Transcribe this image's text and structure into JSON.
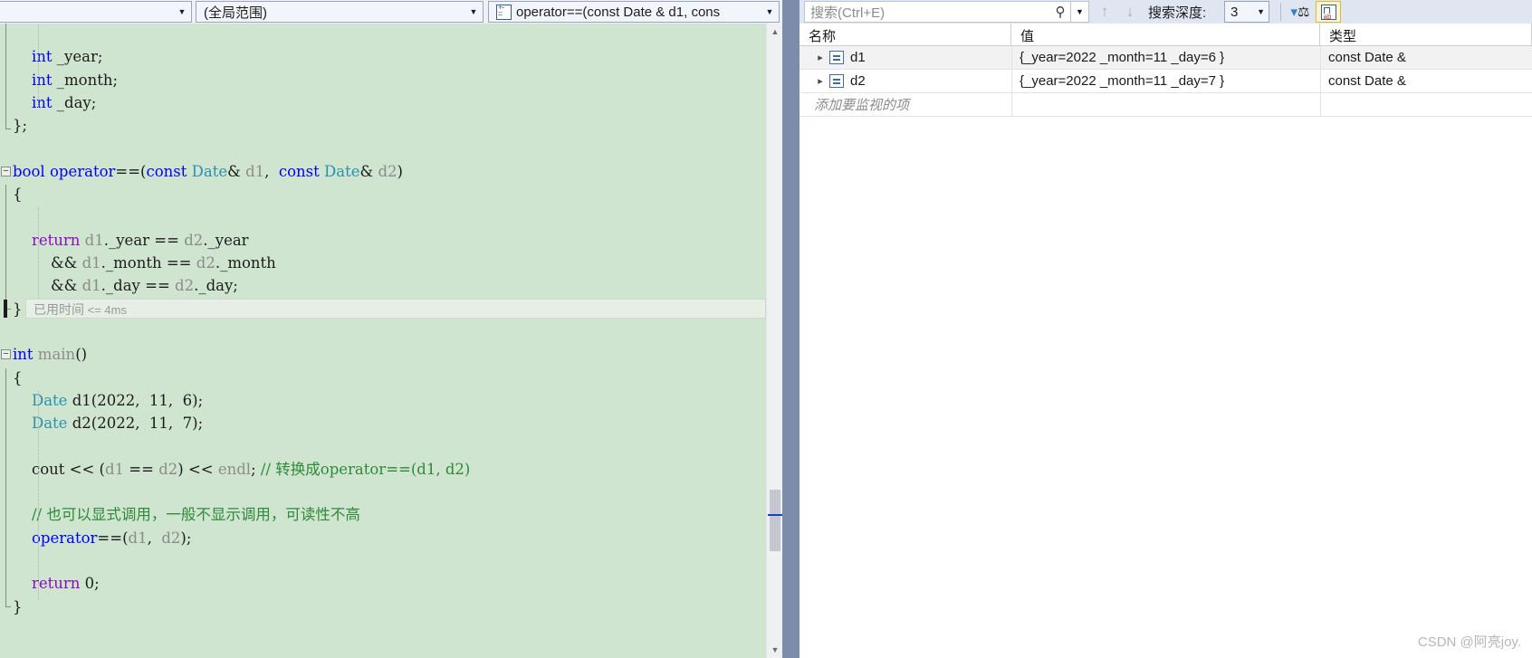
{
  "toolbar": {
    "scope_left": "",
    "global_scope": "(全局范围)",
    "current_function": "operator==(const Date & d1, cons",
    "function_icon": "function-icon",
    "split_icon": "split-view-icon",
    "dropdown_arrow": "▼"
  },
  "watch_toolbar": {
    "search_placeholder": "搜索(Ctrl+E)",
    "search_value": "",
    "search_icon": "magnifier-icon",
    "search_dropdown": "▼",
    "prev_icon": "↑",
    "next_icon": "↓",
    "depth_label": "搜索深度:",
    "depth_value": "3",
    "depth_arrow": "▼",
    "pin_icon": "pin-icon",
    "hex_icon": "hex-display-icon"
  },
  "watch": {
    "columns": [
      "名称",
      "值",
      "类型"
    ],
    "rows": [
      {
        "expander": "▸",
        "icon": "object-icon",
        "name": "d1",
        "value": "{_year=2022 _month=11 _day=6 }",
        "type": "const Date &"
      },
      {
        "expander": "▸",
        "icon": "object-icon",
        "name": "d2",
        "value": "{_year=2022 _month=11 _day=7 }",
        "type": "const Date &"
      }
    ],
    "add_item_placeholder": "添加要监视的项"
  },
  "editor": {
    "elapsed_label": "已用时间",
    "elapsed_value": "<= 4ms",
    "lines": [
      {
        "indent": 0,
        "tokens": []
      },
      {
        "indent": 0,
        "tokens": [
          {
            "t": "    ",
            "c": "pln"
          },
          {
            "t": "int",
            "c": "kw"
          },
          {
            "t": " _year;",
            "c": "pln"
          }
        ]
      },
      {
        "indent": 0,
        "tokens": [
          {
            "t": "    ",
            "c": "pln"
          },
          {
            "t": "int",
            "c": "kw"
          },
          {
            "t": " _month;",
            "c": "pln"
          }
        ]
      },
      {
        "indent": 0,
        "tokens": [
          {
            "t": "    ",
            "c": "pln"
          },
          {
            "t": "int",
            "c": "kw"
          },
          {
            "t": " _day;",
            "c": "pln"
          }
        ]
      },
      {
        "indent": 0,
        "tokens": [
          {
            "t": "};",
            "c": "pln"
          }
        ]
      },
      {
        "indent": 0,
        "tokens": []
      },
      {
        "indent": 0,
        "tokens": [
          {
            "t": "bool",
            "c": "kw"
          },
          {
            "t": " ",
            "c": "pln"
          },
          {
            "t": "operator",
            "c": "kw"
          },
          {
            "t": "==(",
            "c": "pln"
          },
          {
            "t": "const",
            "c": "kw"
          },
          {
            "t": " ",
            "c": "pln"
          },
          {
            "t": "Date",
            "c": "typ"
          },
          {
            "t": "& ",
            "c": "pln"
          },
          {
            "t": "d1",
            "c": "var"
          },
          {
            "t": ",  ",
            "c": "pln"
          },
          {
            "t": "const",
            "c": "kw"
          },
          {
            "t": " ",
            "c": "pln"
          },
          {
            "t": "Date",
            "c": "typ"
          },
          {
            "t": "& ",
            "c": "pln"
          },
          {
            "t": "d2",
            "c": "var"
          },
          {
            "t": ")",
            "c": "pln"
          }
        ]
      },
      {
        "indent": 0,
        "tokens": [
          {
            "t": "{",
            "c": "pln"
          }
        ]
      },
      {
        "indent": 0,
        "tokens": []
      },
      {
        "indent": 0,
        "tokens": [
          {
            "t": "    ",
            "c": "pln"
          },
          {
            "t": "return",
            "c": "ctl"
          },
          {
            "t": " ",
            "c": "pln"
          },
          {
            "t": "d1",
            "c": "var"
          },
          {
            "t": "._year == ",
            "c": "pln"
          },
          {
            "t": "d2",
            "c": "var"
          },
          {
            "t": "._year",
            "c": "pln"
          }
        ]
      },
      {
        "indent": 0,
        "tokens": [
          {
            "t": "        && ",
            "c": "pln"
          },
          {
            "t": "d1",
            "c": "var"
          },
          {
            "t": "._month == ",
            "c": "pln"
          },
          {
            "t": "d2",
            "c": "var"
          },
          {
            "t": "._month",
            "c": "pln"
          }
        ]
      },
      {
        "indent": 0,
        "tokens": [
          {
            "t": "        && ",
            "c": "pln"
          },
          {
            "t": "d1",
            "c": "var"
          },
          {
            "t": "._day == ",
            "c": "pln"
          },
          {
            "t": "d2",
            "c": "var"
          },
          {
            "t": "._day;",
            "c": "pln"
          }
        ]
      },
      {
        "indent": 0,
        "tokens": [
          {
            "t": "}",
            "c": "pln"
          }
        ]
      },
      {
        "indent": 0,
        "tokens": []
      },
      {
        "indent": 0,
        "tokens": [
          {
            "t": "int",
            "c": "kw"
          },
          {
            "t": " ",
            "c": "pln"
          },
          {
            "t": "main",
            "c": "var"
          },
          {
            "t": "()",
            "c": "pln"
          }
        ]
      },
      {
        "indent": 0,
        "tokens": [
          {
            "t": "{",
            "c": "pln"
          }
        ]
      },
      {
        "indent": 0,
        "tokens": [
          {
            "t": "    ",
            "c": "pln"
          },
          {
            "t": "Date",
            "c": "typ"
          },
          {
            "t": " ",
            "c": "pln"
          },
          {
            "t": "d1",
            "c": "pln"
          },
          {
            "t": "(2022,  11,  6);",
            "c": "pln"
          }
        ]
      },
      {
        "indent": 0,
        "tokens": [
          {
            "t": "    ",
            "c": "pln"
          },
          {
            "t": "Date",
            "c": "typ"
          },
          {
            "t": " ",
            "c": "pln"
          },
          {
            "t": "d2",
            "c": "pln"
          },
          {
            "t": "(2022,  11,  7);",
            "c": "pln"
          }
        ]
      },
      {
        "indent": 0,
        "tokens": []
      },
      {
        "indent": 0,
        "tokens": [
          {
            "t": "    cout << (",
            "c": "pln"
          },
          {
            "t": "d1",
            "c": "var"
          },
          {
            "t": " == ",
            "c": "pln"
          },
          {
            "t": "d2",
            "c": "var"
          },
          {
            "t": ") << ",
            "c": "pln"
          },
          {
            "t": "endl",
            "c": "var"
          },
          {
            "t": "; ",
            "c": "pln"
          },
          {
            "t": "// 转换成operator==(d1, d2)",
            "c": "cmt"
          }
        ]
      },
      {
        "indent": 0,
        "tokens": []
      },
      {
        "indent": 0,
        "tokens": [
          {
            "t": "    ",
            "c": "pln"
          },
          {
            "t": "// 也可以显式调用，一般不显示调用，可读性不高",
            "c": "cmt"
          }
        ]
      },
      {
        "indent": 0,
        "tokens": [
          {
            "t": "    ",
            "c": "pln"
          },
          {
            "t": "operator",
            "c": "kw"
          },
          {
            "t": "==(",
            "c": "pln"
          },
          {
            "t": "d1",
            "c": "var"
          },
          {
            "t": ",  ",
            "c": "pln"
          },
          {
            "t": "d2",
            "c": "var"
          },
          {
            "t": ");",
            "c": "pln"
          }
        ]
      },
      {
        "indent": 0,
        "tokens": []
      },
      {
        "indent": 0,
        "tokens": [
          {
            "t": "    ",
            "c": "pln"
          },
          {
            "t": "return",
            "c": "ctl"
          },
          {
            "t": " 0;",
            "c": "pln"
          }
        ]
      },
      {
        "indent": 0,
        "tokens": [
          {
            "t": "}",
            "c": "pln"
          }
        ]
      }
    ]
  },
  "watermark": "CSDN @阿亮joy.",
  "colors": {
    "editor_background": "#cfe5cf",
    "keyword": "#0000ff",
    "type": "#2b91af",
    "control": "#8f08c4",
    "comment": "#2f8a3a",
    "variable": "#8c8c8c",
    "change_bar": "#14811f",
    "splitter": "#7e8cab"
  }
}
